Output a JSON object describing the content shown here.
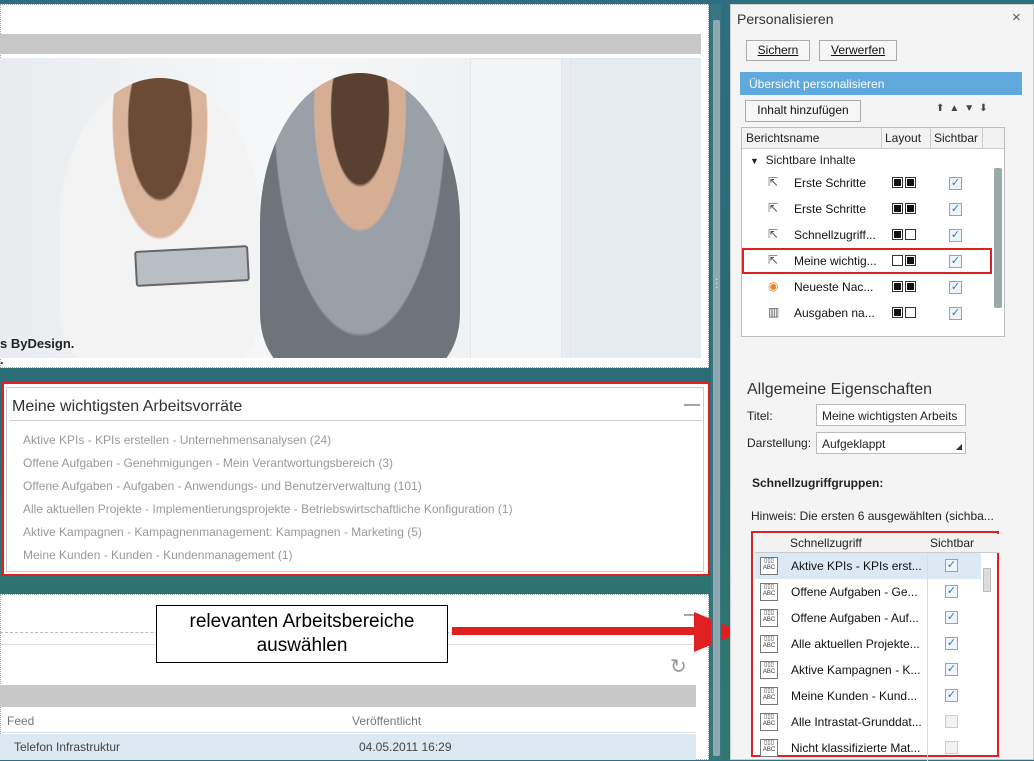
{
  "hero": {
    "text_line1": "s ByDesign.",
    "text_line2": "."
  },
  "arbeitsvorraete": {
    "title": "Meine wichtigsten Arbeitsvorräte",
    "minimize": "—",
    "items": [
      "Aktive KPIs - KPIs erstellen - Unternehmensanalysen (24)",
      "Offene Aufgaben - Genehmigungen - Mein Verantwortungsbereich (3)",
      "Offene Aufgaben - Aufgaben - Anwendungs- und Benutzerverwaltung (101)",
      "Alle aktuellen Projekte - Implementierungsprojekte - Betriebswirtschaftliche Konfiguration (1)",
      "Aktive Kampagnen - Kampagnenmanagement: Kampagnen - Marketing (5)",
      "Meine Kunden - Kunden - Kundenmanagement (1)"
    ]
  },
  "feed": {
    "minimize": "—",
    "col_feed": "Feed",
    "col_published": "Veröffentlicht",
    "row_feed": "Telefon Infrastruktur",
    "row_published": "04.05.2011 16:29"
  },
  "callout": {
    "line1": "relevanten Arbeitsbereiche",
    "line2": "auswählen"
  },
  "panel": {
    "title": "Personalisieren",
    "close": "×",
    "save": "Sichern",
    "discard": "Verwerfen",
    "overview": "Übersicht personalisieren",
    "add_content": "Inhalt hinzufügen",
    "col_name": "Berichtsname",
    "col_layout": "Layout",
    "col_visible": "Sichtbar",
    "group": "Sichtbare Inhalte",
    "rows": [
      {
        "name": "Erste Schritte",
        "layout": [
          true,
          true
        ],
        "visible": true
      },
      {
        "name": "Erste Schritte",
        "layout": [
          true,
          true
        ],
        "visible": true
      },
      {
        "name": "Schnellzugriff...",
        "layout": [
          true,
          false
        ],
        "visible": true
      },
      {
        "name": "Meine wichtig...",
        "layout": [
          false,
          true
        ],
        "visible": true
      },
      {
        "name": "Neueste Nac...",
        "layout": [
          true,
          true
        ],
        "visible": true
      },
      {
        "name": "Ausgaben na...",
        "layout": [
          true,
          false
        ],
        "visible": true
      }
    ],
    "properties_title": "Allgemeine Eigenschaften",
    "title_label": "Titel:",
    "title_value": "Meine wichtigsten Arbeits",
    "display_label": "Darstellung:",
    "display_value": "Aufgeklappt",
    "groups_label": "Schnellzugriffgruppen:",
    "hint": "Hinweis: Die ersten 6 ausgewählten (sichba...",
    "sz_col_name": "Schnellzugriff",
    "sz_col_visible": "Sichtbar",
    "sz_rows": [
      {
        "name": "Aktive KPIs - KPIs erst...",
        "visible": true
      },
      {
        "name": "Offene Aufgaben - Ge...",
        "visible": true
      },
      {
        "name": "Offene Aufgaben - Auf...",
        "visible": true
      },
      {
        "name": "Alle aktuellen Projekte...",
        "visible": true
      },
      {
        "name": "Aktive Kampagnen - K...",
        "visible": true
      },
      {
        "name": "Meine Kunden - Kund...",
        "visible": true
      },
      {
        "name": "Alle Intrastat-Grunddat...",
        "visible": false
      },
      {
        "name": "Nicht klassifizierte Mat...",
        "visible": false
      }
    ]
  },
  "colors": {
    "highlight": "#e02020",
    "accent": "#5fa9dd"
  }
}
